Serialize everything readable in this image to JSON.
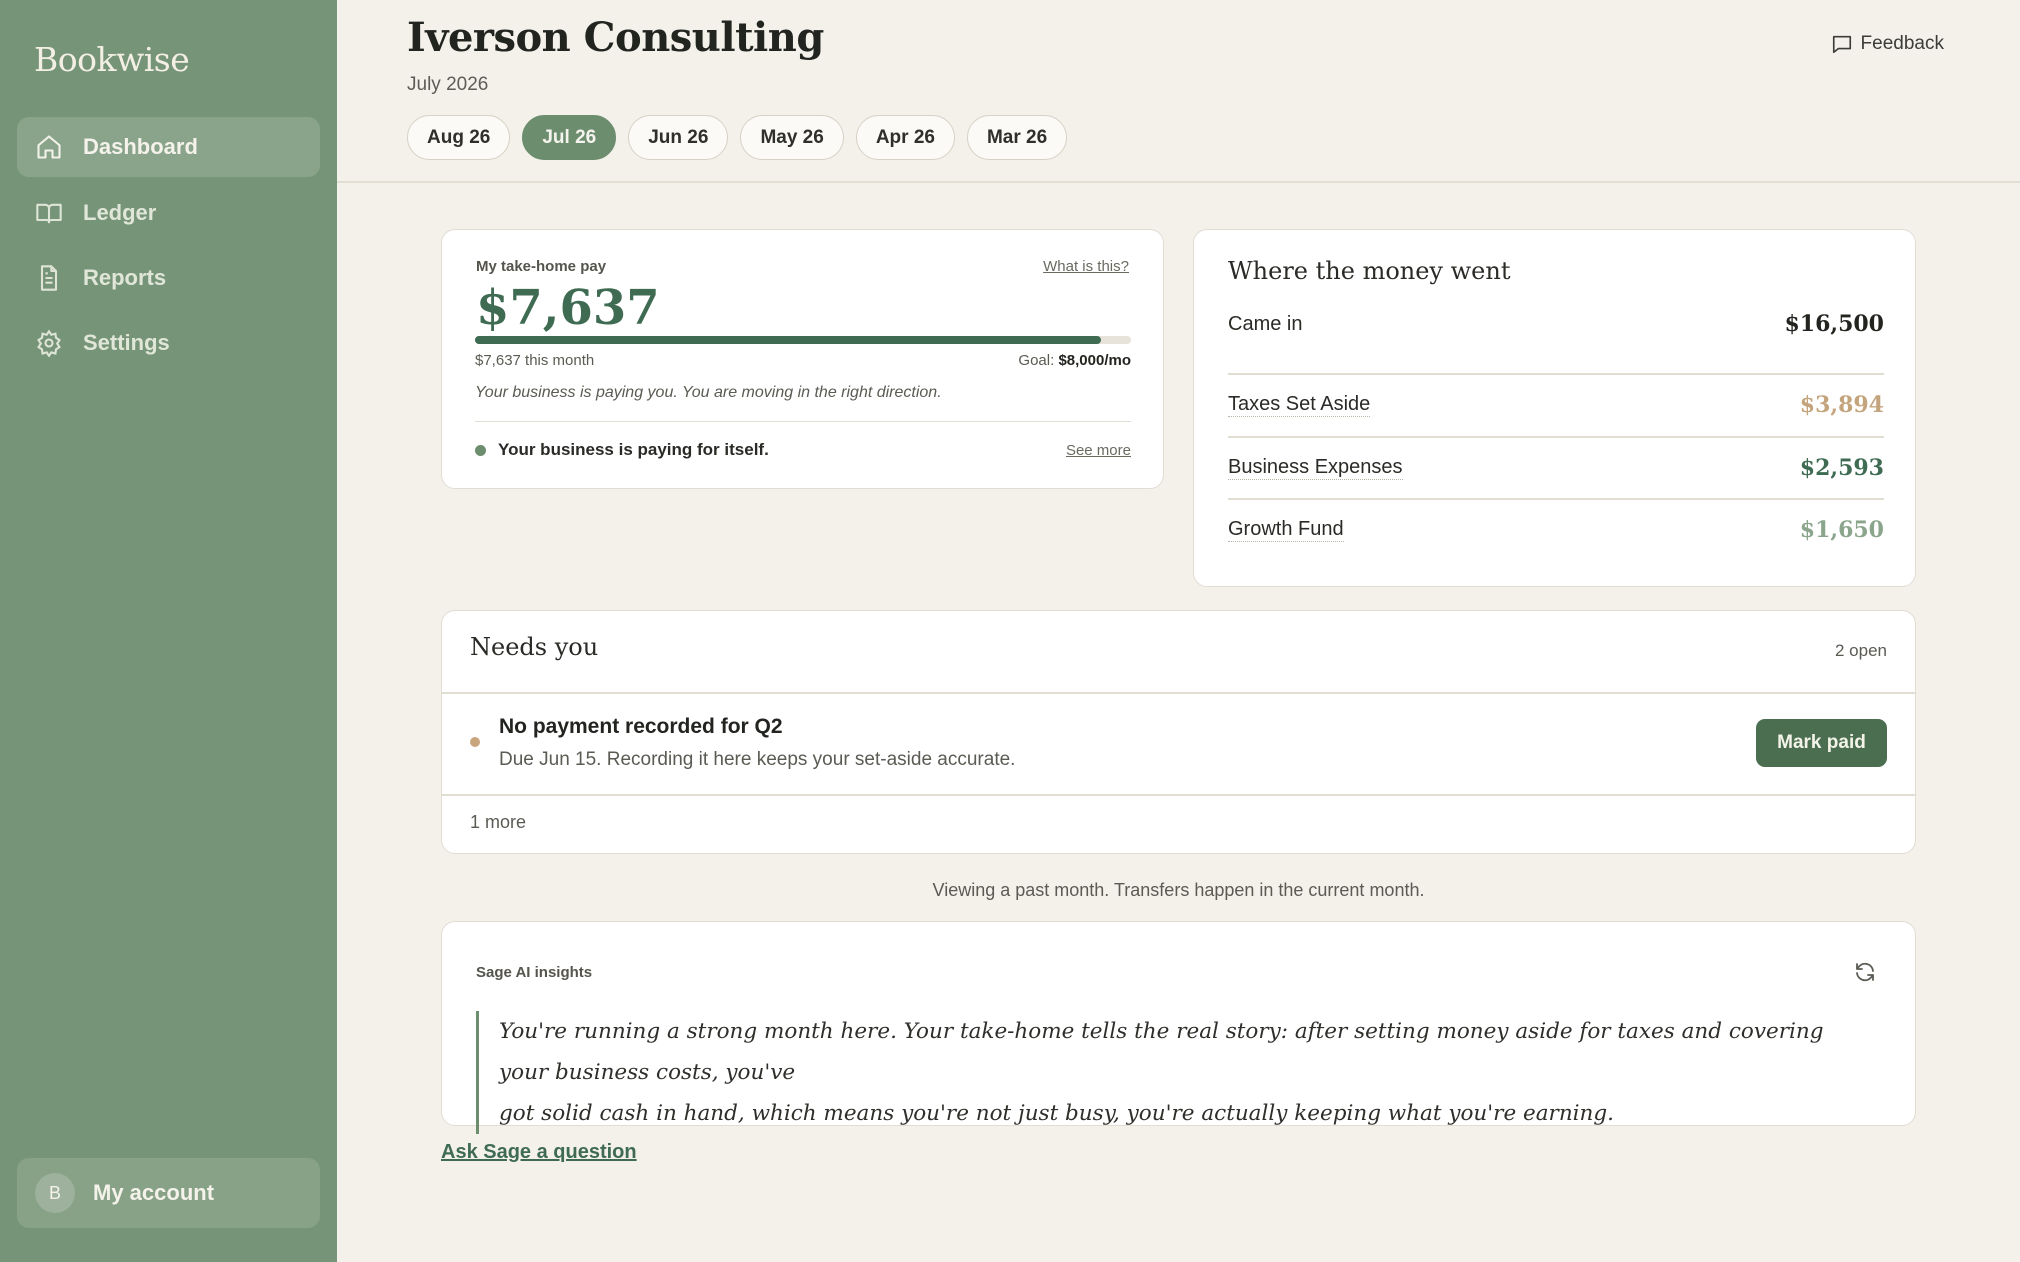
{
  "app": {
    "brand": "Bookwise"
  },
  "sidebar": {
    "items": [
      {
        "label": "Dashboard",
        "icon": "home-icon",
        "active": true
      },
      {
        "label": "Ledger",
        "icon": "book-icon",
        "active": false
      },
      {
        "label": "Reports",
        "icon": "document-icon",
        "active": false
      },
      {
        "label": "Settings",
        "icon": "gear-icon",
        "active": false
      }
    ],
    "account": {
      "initial": "B",
      "label": "My account"
    }
  },
  "header": {
    "title": "Iverson Consulting",
    "subtitle": "July 2026",
    "feedback_label": "Feedback",
    "tabs": [
      {
        "label": "Aug 26",
        "active": false
      },
      {
        "label": "Jul 26",
        "active": true
      },
      {
        "label": "Jun 26",
        "active": false
      },
      {
        "label": "May 26",
        "active": false
      },
      {
        "label": "Apr 26",
        "active": false
      },
      {
        "label": "Mar 26",
        "active": false
      }
    ]
  },
  "takehome": {
    "label": "My take-home pay",
    "help_link": "What is this?",
    "amount": "$7,637",
    "progress_value": 7637,
    "progress_goal": 8000,
    "progress_fraction": 0.955,
    "this_month": "$7,637 this month",
    "goal_prefix": "Goal:",
    "goal_value": "$8,000/mo",
    "message": "Your business is paying you. You are moving in the right direction.",
    "status": "Your business is paying for itself.",
    "status_color": "#6d8d6f",
    "see_more": "See more"
  },
  "money": {
    "title": "Where the money went",
    "rows": [
      {
        "name": "Came in",
        "value": "$16,500",
        "color": "#22241f"
      },
      {
        "name": "Taxes Set Aside",
        "value": "$3,894",
        "color": "#c4a47c"
      },
      {
        "name": "Business Expenses",
        "value": "$2,593",
        "color": "#3f6b53"
      },
      {
        "name": "Growth Fund",
        "value": "$1,650",
        "color": "#8aa58b"
      }
    ]
  },
  "needs": {
    "title": "Needs you",
    "count": "2 open",
    "issue_title": "No payment recorded for Q2",
    "issue_sub": "Due Jun 15. Recording it here keeps your set-aside accurate.",
    "issue_color": "#c9a57e",
    "button": "Mark paid",
    "more": "1 more"
  },
  "viewing_note": "Viewing a past month. Transfers happen in the current month.",
  "sage": {
    "label": "Sage AI insights",
    "quote_line1": "You're running a strong month here. Your take-home tells the real story: after setting money aside for taxes and covering your business costs, you've",
    "quote_line2": "got solid cash in hand, which means you're not just busy, you're actually keeping what you're earning.",
    "ask": "Ask Sage a question"
  },
  "colors": {
    "sidebar": "#769478",
    "accent": "#3f6b53",
    "background": "#f4f1eb"
  }
}
